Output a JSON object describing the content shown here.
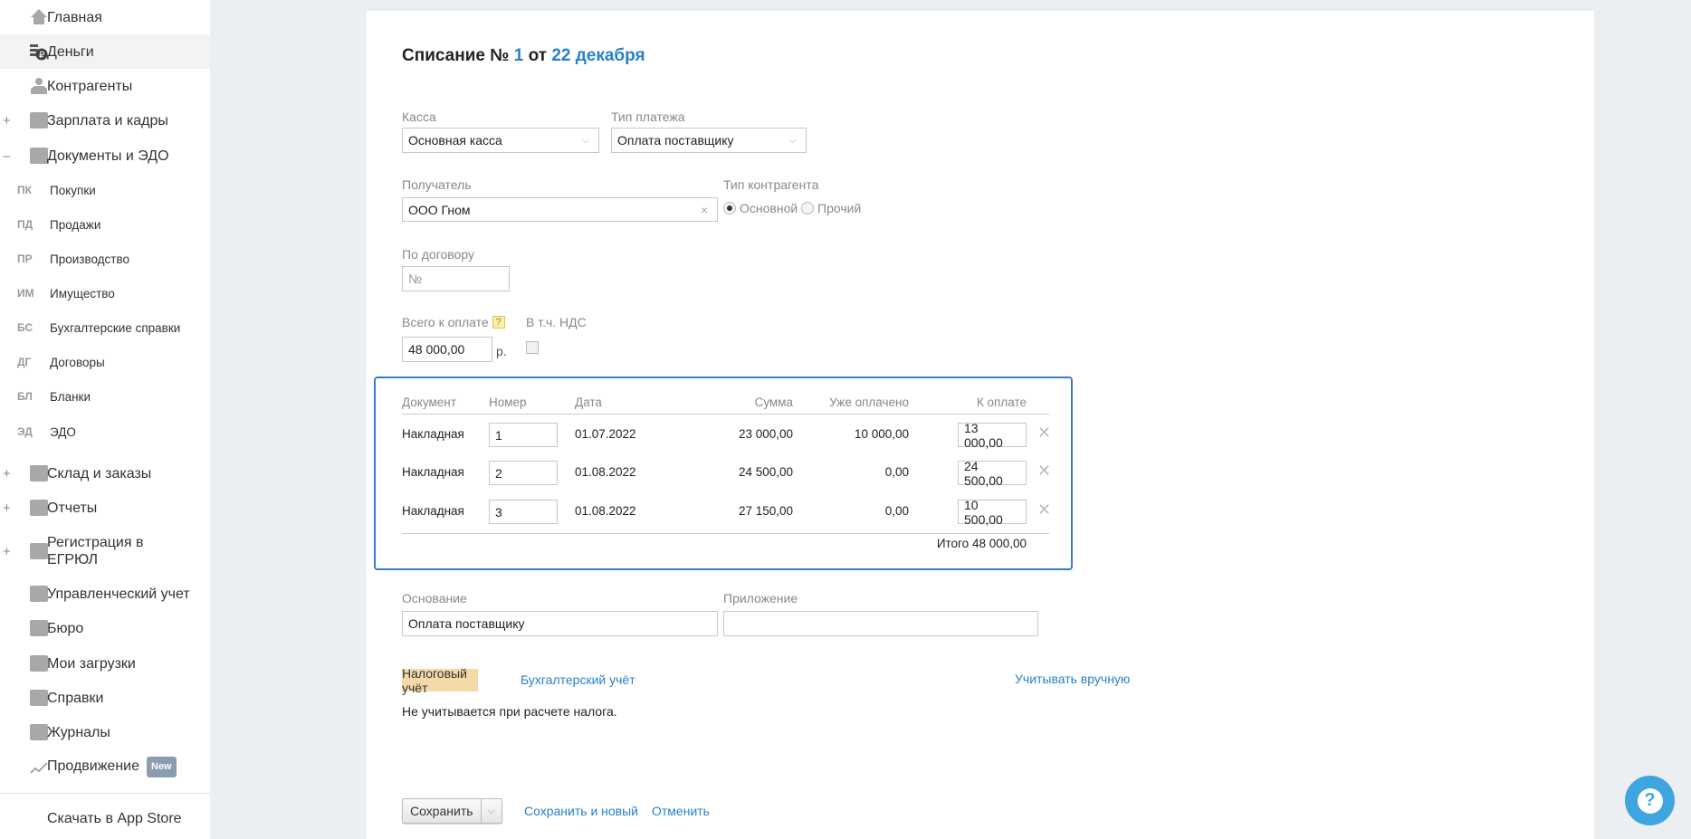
{
  "sidebar": {
    "items": [
      {
        "label": "Главная",
        "icon": "home-icon"
      },
      {
        "label": "Деньги",
        "icon": "money-icon"
      },
      {
        "label": "Контрагенты",
        "icon": "contractors-icon"
      },
      {
        "label": "Зарплата и кадры",
        "icon": "salary-icon",
        "toggle": "+"
      },
      {
        "label": "Документы и ЭДО",
        "icon": "folder-icon",
        "toggle": "–"
      }
    ],
    "subitems": [
      {
        "abbr": "ПК",
        "label": "Покупки"
      },
      {
        "abbr": "ПД",
        "label": "Продажи"
      },
      {
        "abbr": "ПР",
        "label": "Производство"
      },
      {
        "abbr": "ИМ",
        "label": "Имущество"
      },
      {
        "abbr": "БС",
        "label": "Бухгалтерские справки"
      },
      {
        "abbr": "ДГ",
        "label": "Договоры"
      },
      {
        "abbr": "БЛ",
        "label": "Бланки"
      },
      {
        "abbr": "ЭД",
        "label": "ЭДО"
      }
    ],
    "items2": [
      {
        "label": "Склад и заказы",
        "toggle": "+"
      },
      {
        "label": "Отчеты",
        "toggle": "+"
      },
      {
        "label": "Регистрация в",
        "label2": "ЕГРЮЛ",
        "toggle": "+"
      },
      {
        "label": "Управленческий учет"
      },
      {
        "label": "Бюро"
      },
      {
        "label": "Мои загрузки"
      },
      {
        "label": "Справки"
      },
      {
        "label": "Журналы"
      },
      {
        "label": "Продвижение",
        "badge": "New"
      }
    ],
    "appstore": "Скачать в App Store"
  },
  "form": {
    "title_prefix": "Списание №",
    "number": "1",
    "title_mid": "от",
    "date": "22 декабря",
    "kassa_label": "Касса",
    "kassa_value": "Основная касса",
    "paytype_label": "Тип платежа",
    "paytype_value": "Оплата поставщику",
    "recipient_label": "Получатель",
    "recipient_value": "ООО Гном",
    "ctype_label": "Тип контрагента",
    "ctype_options": [
      "Основной",
      "Прочий"
    ],
    "contract_label": "По договору",
    "contract_placeholder": "№",
    "total_label": "Всего к оплате",
    "total_help": "?",
    "total_value": "48 000,00",
    "currency": "р.",
    "vat_label": "В т.ч. НДС",
    "basis_label": "Основание",
    "basis_value": "Оплата поставщику",
    "attachment_label": "Приложение",
    "attachment_value": ""
  },
  "table": {
    "headers": [
      "Документ",
      "Номер",
      "Дата",
      "Сумма",
      "Уже оплачено",
      "К оплате"
    ],
    "rows": [
      {
        "doc": "Накладная",
        "num": "1",
        "date": "01.07.2022",
        "sum": "23 000,00",
        "paid": "10 000,00",
        "topay": "13 000,00"
      },
      {
        "doc": "Накладная",
        "num": "2",
        "date": "01.08.2022",
        "sum": "24 500,00",
        "paid": "0,00",
        "topay": "24 500,00"
      },
      {
        "doc": "Накладная",
        "num": "3",
        "date": "01.08.2022",
        "sum": "27 150,00",
        "paid": "0,00",
        "topay": "10 500,00"
      }
    ],
    "total": "Итого 48 000,00"
  },
  "accounting": {
    "tab_tax": "Налоговый учёт",
    "tab_book": "Бухгалтерский учёт",
    "manual": "Учитывать вручную",
    "note": "Не учитывается при расчете налога."
  },
  "actions": {
    "save": "Сохранить",
    "save_new": "Сохранить и новый",
    "cancel": "Отменить"
  },
  "help": "?",
  "colors": {
    "accent": "#2a80c6",
    "highlight": "#3a7bc8",
    "tab": "#f5d9a8",
    "help": "#3ea5e0"
  }
}
